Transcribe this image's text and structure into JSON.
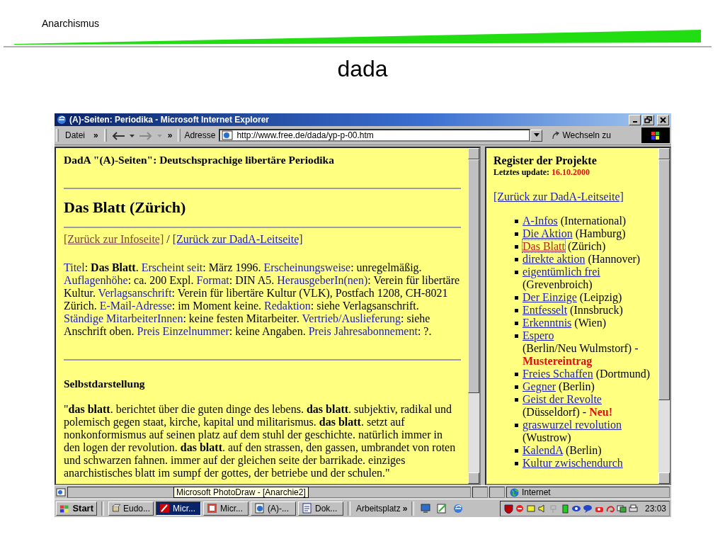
{
  "slide": {
    "header": "Anarchismus",
    "title": "dada"
  },
  "window": {
    "title": "(A)-Seiten: Periodika - Microsoft Internet Explorer"
  },
  "toolbar": {
    "menu": "Datei",
    "more_menu": "»",
    "more_nav": "»",
    "address_label": "Adresse",
    "address": "http://www.free.de/dada/yp-p-00.htm",
    "go": "Wechseln zu"
  },
  "main_frame": {
    "heading": "DadA \"(A)-Seiten\": Deutschsprachige libertäre Periodika",
    "title": "Das Blatt (Zürich)",
    "links": [
      {
        "text": "[Zurück zur Infoseite]",
        "visited": true
      },
      {
        "text": "[Zurück zur DadA-Leitseite]",
        "visited": false
      }
    ],
    "link_separator": "/",
    "fields": [
      {
        "label": "Titel",
        "text": ": **Das Blatt**."
      },
      {
        "label": "Erscheint seit",
        "text": ": März 1996."
      },
      {
        "label": "Erscheinungsweise",
        "text": ": unregelmäßig."
      },
      {
        "label": "Auflagenhöhe",
        "text": ": ca. 200 Expl."
      },
      {
        "label": "Format",
        "text": ": DIN A5."
      },
      {
        "label": "HerausgeberIn(nen)",
        "text": ": Verein für libertäre Kultur."
      },
      {
        "label": "Verlagsanschrift",
        "text": ": Verein für libertäre Kultur (VLK), Postfach 1208, CH-8021 Zürich."
      },
      {
        "label": "E-Mail-Adresse",
        "text": ": im Moment keine."
      },
      {
        "label": "Redaktion",
        "text": ": siehe Verlagsanschrift."
      },
      {
        "label": "Ständige MitarbeiterInnen",
        "text": ": keine festen Mitarbeiter."
      },
      {
        "label": "Vertrieb/Auslieferung",
        "text": ": siehe Anschrift oben."
      },
      {
        "label": "Preis Einzelnummer",
        "text": ": keine Angaben."
      },
      {
        "label": "Preis Jahresabonnement",
        "text": ": ?."
      }
    ],
    "section_title": "Selbstdarstellung",
    "quote": "\"**das blatt**. berichtet über die guten dinge des lebens. **das blatt**. subjektiv, radikal und polemisch gegen staat, kirche, kapital und militarismus. **das blatt**. setzt auf nonkonformismus auf seinen platz auf dem stuhl der geschichte. natürlich immer in den logen der revolution. **das blatt**. auf den strassen, den gassen, umbrandet von roten und schwarzen fahnen. immer auf der gleichen seite der barrikade. einziges anarchistisches blatt im sumpf der gottes, der betriebe und der schulen.\""
  },
  "side_frame": {
    "title": "Register der Projekte",
    "update_label": "Letztes update:",
    "update_date": "16.10.2000",
    "back_link": "[Zurück zur DadA-Leitseite]",
    "projects": [
      {
        "name": "A-Infos",
        "place": "(International)",
        "focused": false
      },
      {
        "name": "Die Aktion",
        "place": "(Hamburg)",
        "focused": false
      },
      {
        "name": "Das Blatt",
        "place": "(Zürich)",
        "focused": true
      },
      {
        "name": "direkte aktion",
        "place": "(Hannover)",
        "focused": false
      },
      {
        "name": "eigentümlich frei",
        "place": "(Grevenbroich)",
        "focused": false
      },
      {
        "name": "Der Einzige",
        "place": "(Leipzig)",
        "focused": false
      },
      {
        "name": "Entfesselt",
        "place": "(Innsbruck)",
        "focused": false
      },
      {
        "name": "Erkenntnis",
        "place": "(Wien)",
        "focused": false
      },
      {
        "name": "Espero",
        "place": "(Berlin/Neu Wulmstorf) -",
        "note": "Mustereintrag",
        "focused": false
      },
      {
        "name": "Freies Schaffen",
        "place": "(Dortmund)",
        "focused": false
      },
      {
        "name": "Gegner",
        "place": "(Berlin)",
        "focused": false
      },
      {
        "name": "Geist der Revolte",
        "place": "(Düsseldorf) -",
        "note": "Neu!",
        "focused": false
      },
      {
        "name": "graswurzel revolution",
        "place": "(Wustrow)",
        "focused": false
      },
      {
        "name": "KalendA",
        "place": "(Berlin)",
        "focused": false
      },
      {
        "name": "Kultur zwischendurch",
        "focused": false
      }
    ]
  },
  "status_bar": {
    "zone": "Internet"
  },
  "taskbar": {
    "start": "Start",
    "buttons": [
      {
        "label": "Eudo...",
        "active": false
      },
      {
        "label": "Micr...",
        "active": true
      },
      {
        "label": "Micr...",
        "active": false
      },
      {
        "label": "(A)-...",
        "active": false
      },
      {
        "label": "Dok...",
        "active": false
      }
    ],
    "toolbar_label": "Arbeitsplatz",
    "more": "»",
    "clock": "23:03",
    "tooltip": "Microsoft PhotoDraw - [Anarchie2]"
  }
}
